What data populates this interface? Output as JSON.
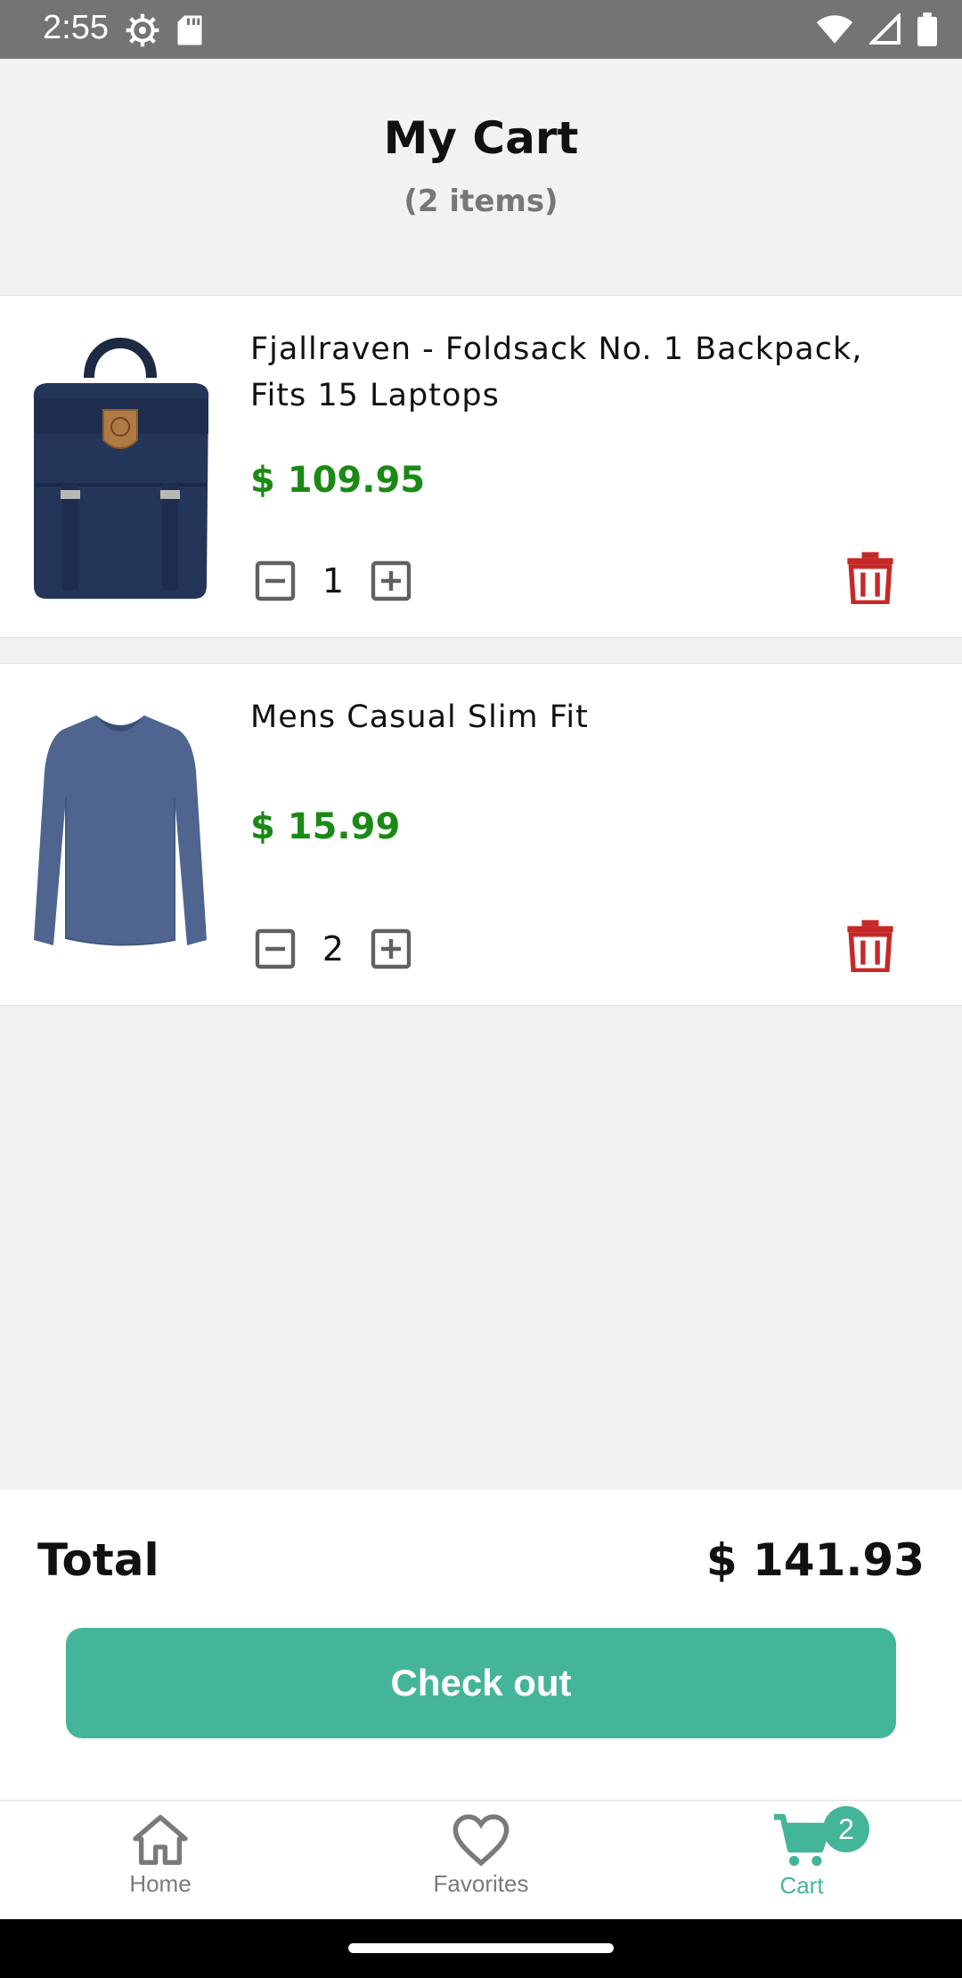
{
  "status_bar": {
    "time": "2:55",
    "left_icons": [
      "settings-icon",
      "sd-card-icon"
    ],
    "right_icons": [
      "wifi-icon",
      "signal-icon",
      "battery-icon"
    ]
  },
  "header": {
    "title": "My Cart",
    "item_count": "(2 items)"
  },
  "cart_items": [
    {
      "name": "Fjallraven - Foldsack No. 1 Backpack, Fits 15 Laptops",
      "price": "$ 109.95",
      "quantity": "1",
      "image_icon": "backpack-image"
    },
    {
      "name": "Mens Casual Slim Fit",
      "price": "$ 15.99",
      "quantity": "2",
      "image_icon": "shirt-image"
    }
  ],
  "summary": {
    "total_label": "Total",
    "total_value": "$ 141.93",
    "checkout_label": "Check out"
  },
  "nav": {
    "items": [
      {
        "label": "Home",
        "icon": "home-icon"
      },
      {
        "label": "Favorites",
        "icon": "heart-icon"
      },
      {
        "label": "Cart",
        "icon": "cart-icon"
      }
    ],
    "cart_badge": "2"
  },
  "colors": {
    "accent": "#45b59a",
    "price": "#1a8a14",
    "delete": "#c62828",
    "status_bar": "#747474"
  }
}
